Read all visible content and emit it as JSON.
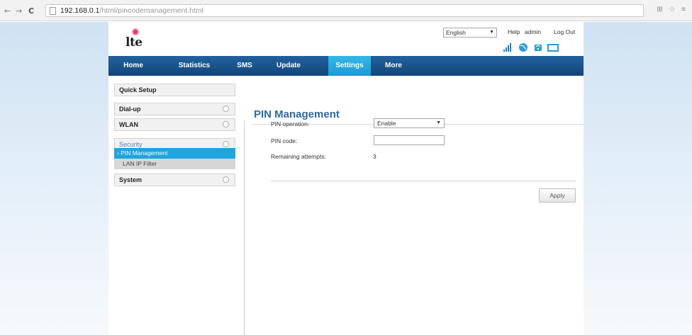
{
  "browser": {
    "back": "←",
    "forward": "→",
    "reload": "C",
    "url_host": "192.168.0.1",
    "url_path": "/html/pincodemanagement.html"
  },
  "header": {
    "logo_text": "lte",
    "language": "English",
    "help": "Help",
    "user": "admin",
    "logout": "Log Out"
  },
  "nav": {
    "items": [
      "Home",
      "Statistics",
      "SMS",
      "Update",
      "Settings",
      "More"
    ],
    "active": "Settings"
  },
  "sidebar": {
    "quick_setup": "Quick Setup",
    "dialup": "Dial-up",
    "wlan": "WLAN",
    "security": "Security",
    "pin_management": "› PIN Management",
    "lan_ip_filter": "LAN IP Filter",
    "system": "System"
  },
  "main": {
    "title": "PIN Management",
    "pin_operation_label": "PIN operation:",
    "pin_operation_value": "Enable",
    "pin_code_label": "PIN code:",
    "pin_code_value": "",
    "remaining_label": "Remaining attempts:",
    "remaining_value": "3",
    "apply": "Apply"
  },
  "colors": {
    "nav_bg": "#1a5189",
    "nav_active": "#1fa4dc",
    "title": "#2d68a8",
    "sub_active": "#1fa4dc"
  }
}
